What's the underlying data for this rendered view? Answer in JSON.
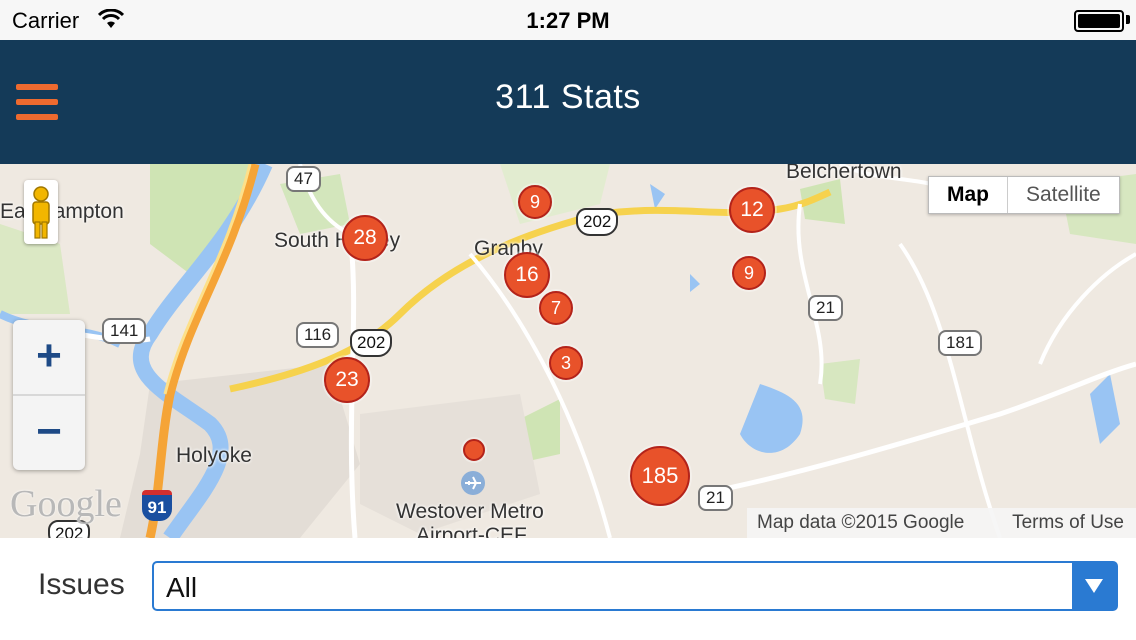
{
  "status_bar": {
    "carrier": "Carrier",
    "time": "1:27 PM"
  },
  "nav": {
    "title": "311 Stats",
    "menu_icon": "hamburger-menu-icon"
  },
  "map": {
    "places": [
      "Easthampton",
      "South Hadley",
      "Granby",
      "Belchertown",
      "Holyoke",
      "Westover Metro",
      "Airport-CEF"
    ],
    "route_shields": [
      "47",
      "141",
      "116",
      "202",
      "202",
      "21",
      "21",
      "181",
      "91",
      "202"
    ],
    "clusters": [
      {
        "label": "28"
      },
      {
        "label": "9"
      },
      {
        "label": "12"
      },
      {
        "label": "16"
      },
      {
        "label": "7"
      },
      {
        "label": "9"
      },
      {
        "label": "3"
      },
      {
        "label": "23"
      },
      {
        "label": "185"
      },
      {
        "label": ""
      }
    ],
    "map_type": {
      "map": "Map",
      "satellite": "Satellite",
      "selected": "Map"
    },
    "zoom_in": "+",
    "zoom_out": "−",
    "logo": "Google",
    "attribution": "Map data ©2015 Google",
    "terms": "Terms of Use"
  },
  "filter": {
    "label": "Issues",
    "value": "All"
  },
  "colors": {
    "nav_bg": "#143a58",
    "accent": "#ee6a2f",
    "cluster": "#e8522a",
    "select_blue": "#2a7ad2"
  }
}
